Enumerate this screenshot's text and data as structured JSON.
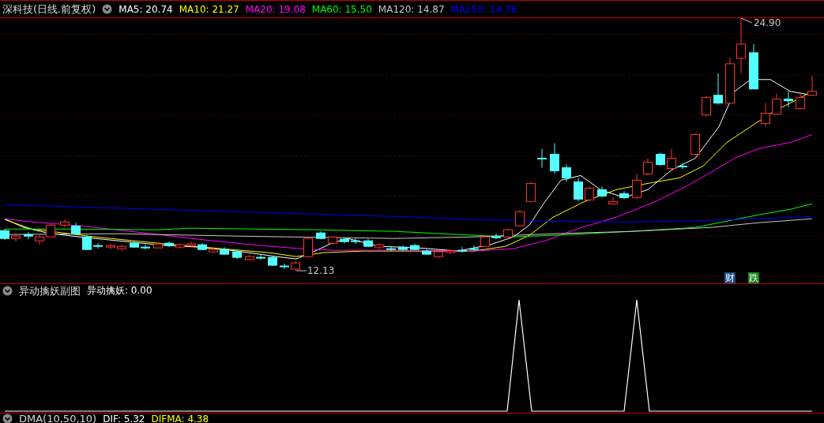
{
  "main_panel": {
    "title": "深科技(日线.前复权)",
    "indicators": [
      {
        "label": "MA5: 20.74",
        "color": "#ffffff"
      },
      {
        "label": "MA10: 21.27",
        "color": "#ffff00"
      },
      {
        "label": "MA20: 19.08",
        "color": "#ff00ff"
      },
      {
        "label": "MA60: 15.50",
        "color": "#00ff00"
      },
      {
        "label": "MA120: 14.87",
        "color": "#c8c8c8"
      },
      {
        "label": "MA250: 14.76",
        "color": "#0000ff"
      }
    ],
    "high_label": "24.90",
    "low_label": "12.13",
    "badges": [
      {
        "text": "财",
        "color": "#1b4b87"
      },
      {
        "text": "跌",
        "color": "#13861d"
      }
    ]
  },
  "sub_panel": {
    "title": "异动擒妖副图",
    "readings": [
      {
        "label": "异动擒妖: 0.00",
        "color": "#ffffff"
      }
    ]
  },
  "bottom_panel": {
    "title": "DMA(10,50,10)",
    "readings": [
      {
        "label": "DIF: 5.32",
        "color": "#ffffff"
      },
      {
        "label": "DIFMA: 4.38",
        "color": "#ffff00"
      }
    ]
  }
}
